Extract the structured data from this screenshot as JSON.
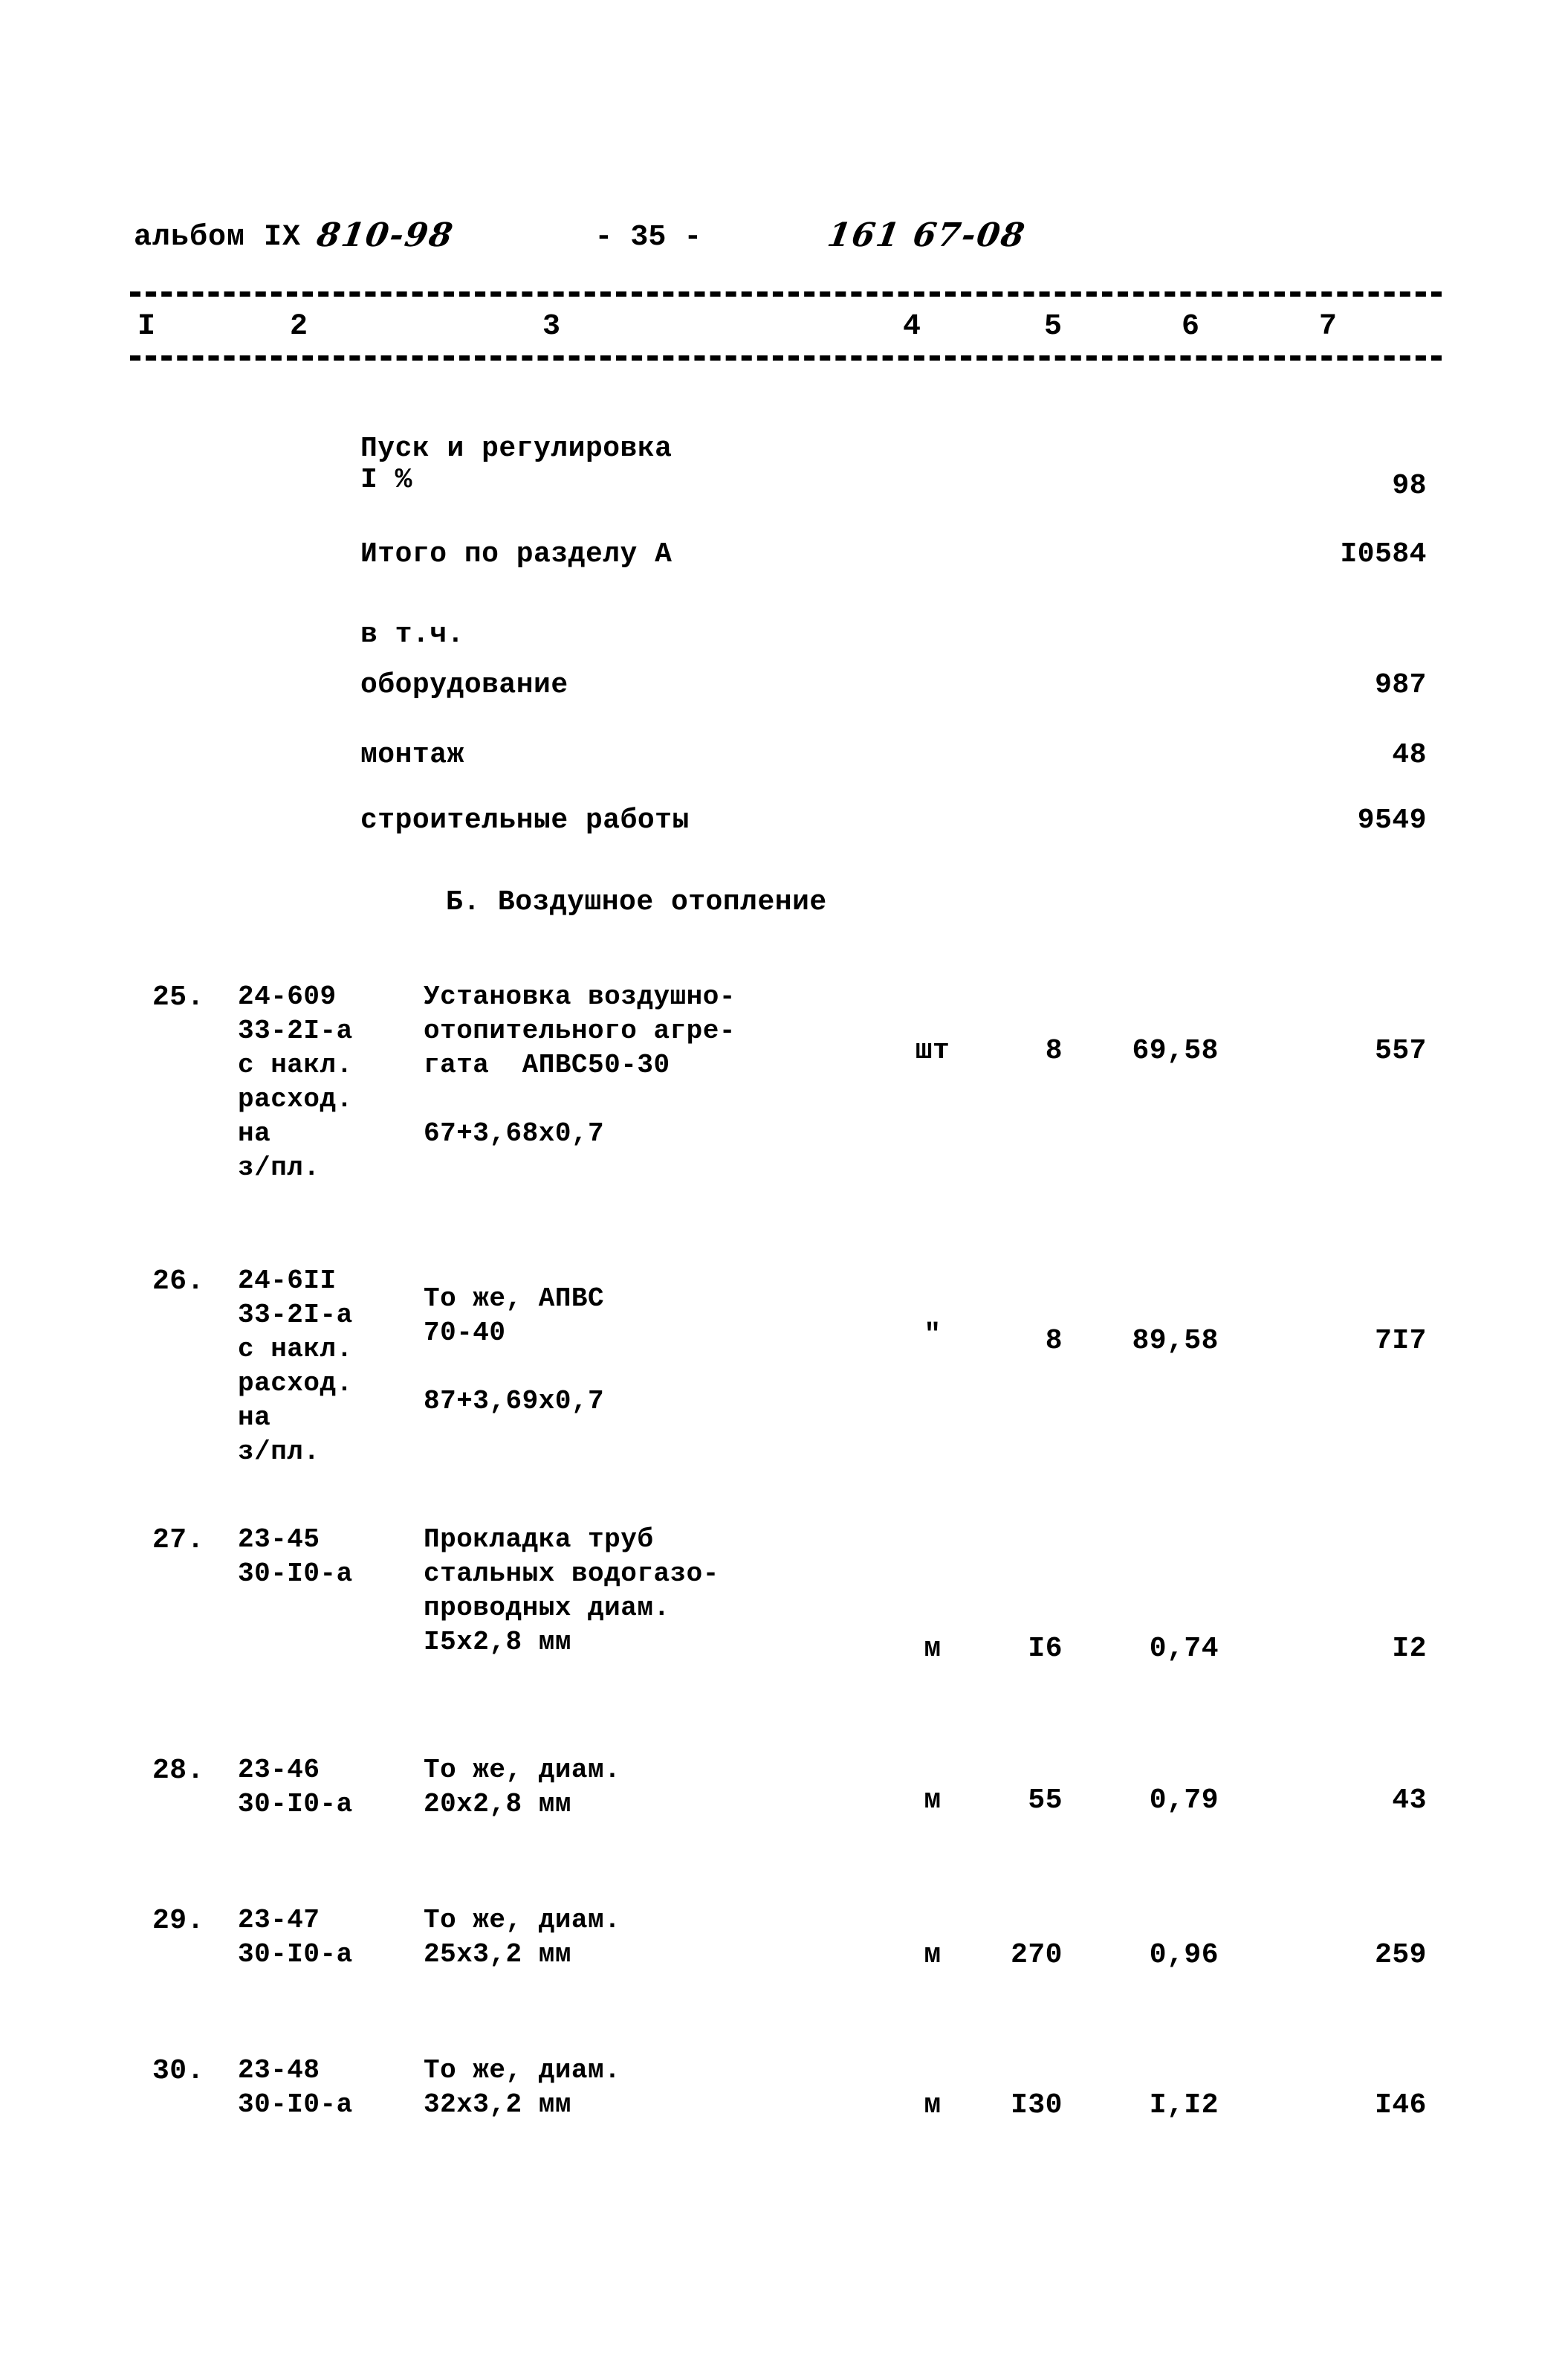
{
  "header": {
    "album_label": "альбом IX",
    "album_code": "810-98",
    "page_number": "- 35 -",
    "doc_code": "161 67-08"
  },
  "column_numbers": [
    "I",
    "2",
    "3",
    "4",
    "5",
    "6",
    "7"
  ],
  "summary": {
    "startup_line1": "Пуск и регулировка",
    "startup_line2": "I %",
    "startup_value": "98",
    "total_label": "Итого по разделу А",
    "total_value": "I0584",
    "breakdown_label": "в т.ч.",
    "items": [
      {
        "label": "оборудование",
        "value": "987"
      },
      {
        "label": "монтаж",
        "value": "48"
      },
      {
        "label": "строительные работы",
        "value": "9549"
      }
    ]
  },
  "section": {
    "title": "Б. Воздушное отопление"
  },
  "rows": [
    {
      "index": "25.",
      "code_lines": [
        "24-609",
        "33-2I-а",
        "с накл.",
        "расход.",
        "на",
        "з/пл."
      ],
      "desc_lines": [
        "Установка воздушно-",
        "отопительного агре-",
        "гата  АПВС50-30",
        "",
        "67+3,68х0,7"
      ],
      "unit": "шт",
      "qty": "8",
      "price": "69,58",
      "total": "557"
    },
    {
      "index": "26.",
      "code_lines": [
        "24-6II",
        "33-2I-а",
        "с накл.",
        "расход.",
        "на",
        "з/пл."
      ],
      "desc_lines": [
        "То же, АПВС",
        "70-40",
        "",
        "87+3,69х0,7"
      ],
      "unit": "\"",
      "qty": "8",
      "price": "89,58",
      "total": "7I7"
    },
    {
      "index": "27.",
      "code_lines": [
        "23-45",
        "30-I0-а"
      ],
      "desc_lines": [
        "Прокладка труб",
        "стальных водогазо-",
        "проводных диам.",
        "I5х2,8 мм"
      ],
      "unit": "м",
      "qty": "I6",
      "price": "0,74",
      "total": "I2"
    },
    {
      "index": "28.",
      "code_lines": [
        "23-46",
        "30-I0-а"
      ],
      "desc_lines": [
        "То же, диам.",
        "20х2,8 мм"
      ],
      "unit": "м",
      "qty": "55",
      "price": "0,79",
      "total": "43"
    },
    {
      "index": "29.",
      "code_lines": [
        "23-47",
        "30-I0-а"
      ],
      "desc_lines": [
        "То же, диам.",
        "25х3,2 мм"
      ],
      "unit": "м",
      "qty": "270",
      "price": "0,96",
      "total": "259"
    },
    {
      "index": "30.",
      "code_lines": [
        "23-48",
        "30-I0-а"
      ],
      "desc_lines": [
        "То же, диам.",
        "32х3,2 мм"
      ],
      "unit": "м",
      "qty": "I30",
      "price": "I,I2",
      "total": "I46"
    }
  ]
}
